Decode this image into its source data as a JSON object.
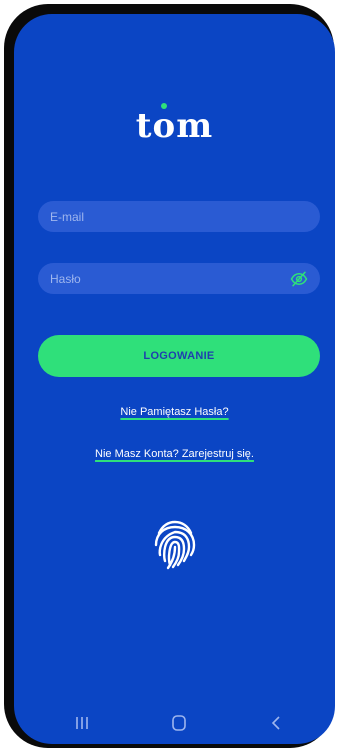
{
  "app": {
    "logo": {
      "prefix": "t",
      "dotted_letter": "o",
      "suffix": "m"
    },
    "accent_color": "#2fe07a",
    "background_color": "#0b45c4"
  },
  "form": {
    "email_placeholder": "E-mail",
    "password_placeholder": "Hasło",
    "password_toggle_icon": "eye-slash-icon",
    "login_label": "LOGOWANIE"
  },
  "links": {
    "forgot_password": "Nie Pamiętasz Hasła?",
    "register": "Nie Masz Konta? Zarejestruj się."
  },
  "biometric": {
    "icon": "fingerprint-icon"
  },
  "system_nav": {
    "recent_icon": "recent-apps-icon",
    "home_icon": "home-icon",
    "back_icon": "back-icon"
  }
}
